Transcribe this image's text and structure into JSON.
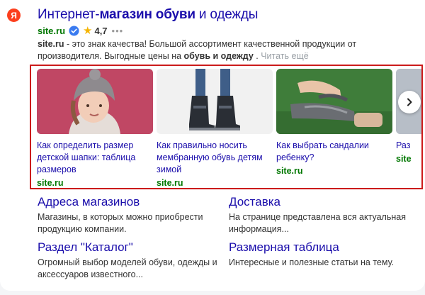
{
  "logo": {
    "letter": "Я"
  },
  "result": {
    "title_part1": "Интернет-",
    "title_bold": "магазин обуви",
    "title_part2": " и одежды",
    "site": "site.ru",
    "rating": "4,7",
    "dots": "•••",
    "desc_site": "site.ru",
    "desc_text1": " - это знак качества! Большой ассортимент качественной продукции от производителя. Выгодные цены на ",
    "desc_bold": "обувь и одежду",
    "desc_text2": " . ",
    "desc_more": "Читать ещё"
  },
  "carousel": {
    "items": [
      {
        "title": "Как определить размер детской шапки: таблица размеров",
        "site": "site.ru"
      },
      {
        "title": "Как правильно носить мембранную обувь детям зимой",
        "site": "site.ru"
      },
      {
        "title": "Как выбрать сандалии ребенку?",
        "site": "site.ru"
      },
      {
        "title": "Раз",
        "site": "site"
      }
    ]
  },
  "sitelinks": [
    {
      "title": "Адреса магазинов",
      "desc": "Магазины, в которых можно приобрести продукцию компании."
    },
    {
      "title": "Доставка",
      "desc": "На странице представлена вся актуальная информация..."
    },
    {
      "title": "Раздел \"Каталог\"",
      "desc": "Огромный выбор моделей обуви, одежды и аксессуаров известного..."
    },
    {
      "title": "Размерная таблица",
      "desc": "Интересные и полезные статьи на тему."
    }
  ],
  "colors": {
    "link": "#1a0dab",
    "site": "#007700",
    "highlight_border": "#cc1b1b",
    "yandex": "#fc3f1d",
    "star": "#f5b400"
  }
}
